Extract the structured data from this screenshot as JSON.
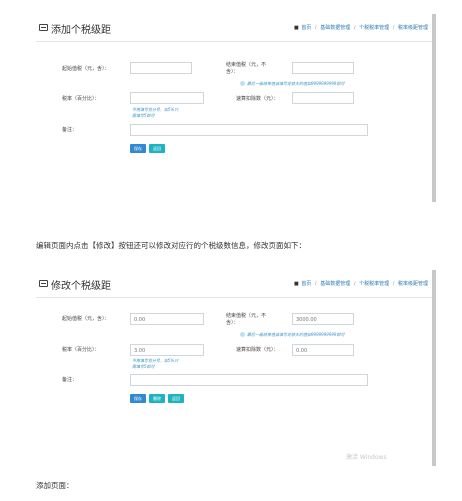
{
  "add_page": {
    "title": "添加个税级距",
    "breadcrumb": {
      "home": "首页",
      "b2": "基础数据管理",
      "b3": "个税税率管理",
      "b4": "税率级距管理"
    },
    "start_label": "起始值税（元，含）：",
    "start_value": "",
    "end_label": "结束值税（元，不含）：",
    "end_value": "",
    "end_hint": "最后一级结束值请填写足够大的值如9999999999即可",
    "rate_label": "税率（百分比）：",
    "rate_value": "",
    "rate_hint": "不用填写百分号，如5%只需填写5即可",
    "deduction_label": "速算扣除数（元）：",
    "deduction_value": "",
    "remark_label": "备注：",
    "remark_value": "",
    "buttons": {
      "save": "保存",
      "back": "返回"
    }
  },
  "paragraph1": "编辑页面内点击【修改】按钮还可以修改对应行的个税级数信息，修改页面如下：",
  "edit_page": {
    "title": "修改个税级距",
    "breadcrumb": {
      "home": "首页",
      "b2": "基础数据管理",
      "b3": "个税税率管理",
      "b4": "税率级距管理"
    },
    "start_label": "起始值税（元，含）：",
    "start_value": "0.00",
    "end_label": "结束值税（元，不含）：",
    "end_value": "3000.00",
    "end_hint": "最后一级结束值请填写足够大的值如9999999999即可",
    "rate_label": "税率（百分比）：",
    "rate_value": "3.00",
    "rate_hint": "不用填写百分号，如5%只需填写5即可",
    "deduction_label": "速算扣除数（元）：",
    "deduction_value": "0.00",
    "remark_label": "备注：",
    "remark_value": "",
    "buttons": {
      "save": "保存",
      "delete": "删除",
      "back": "返回"
    },
    "watermark": "激活 Windows"
  },
  "paragraph2": "添加页面："
}
